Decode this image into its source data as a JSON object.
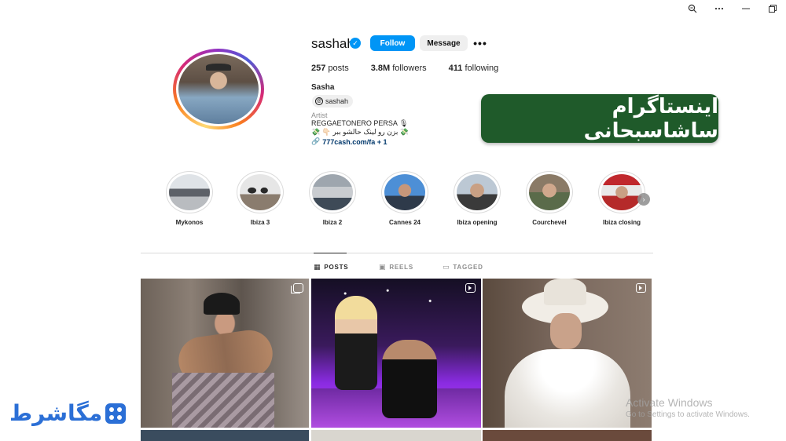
{
  "window": {
    "zoom_icon": "zoom-icon",
    "more_icon": "more-icon",
    "minimize_icon": "minimize-icon",
    "restore_icon": "restore-icon"
  },
  "profile": {
    "username": "sashah",
    "follow_label": "Follow",
    "message_label": "Message",
    "more_label": "•••",
    "posts_count": "257",
    "posts_label": "posts",
    "followers_count": "3.8M",
    "followers_label": "followers",
    "following_count": "411",
    "following_label": "following",
    "full_name": "Sasha",
    "threads_handle": "sashah",
    "category": "Artist",
    "bio_line1": "REGGAETONERO PERSA 🎙",
    "bio_line2": "💸 بزن رو لینک حالشو ببر 👇🏻 💸",
    "link_text": "777cash.com/fa + 1",
    "accent_color": "#0095f6"
  },
  "banner": {
    "text": "اینستاگرام ساشاسبحانی",
    "color": "#1f5a2a"
  },
  "highlights": [
    {
      "label": "Mykonos"
    },
    {
      "label": "Ibiza 3"
    },
    {
      "label": "Ibiza 2"
    },
    {
      "label": "Cannes 24"
    },
    {
      "label": "Ibiza opening"
    },
    {
      "label": "Courchevel"
    },
    {
      "label": "Ibiza closing"
    }
  ],
  "tabs": {
    "posts": "POSTS",
    "reels": "REELS",
    "tagged": "TAGGED"
  },
  "watermark": {
    "line1": "Activate Windows",
    "line2": "Go to Settings to activate Windows."
  },
  "logo": {
    "text": "مگاشرط"
  }
}
